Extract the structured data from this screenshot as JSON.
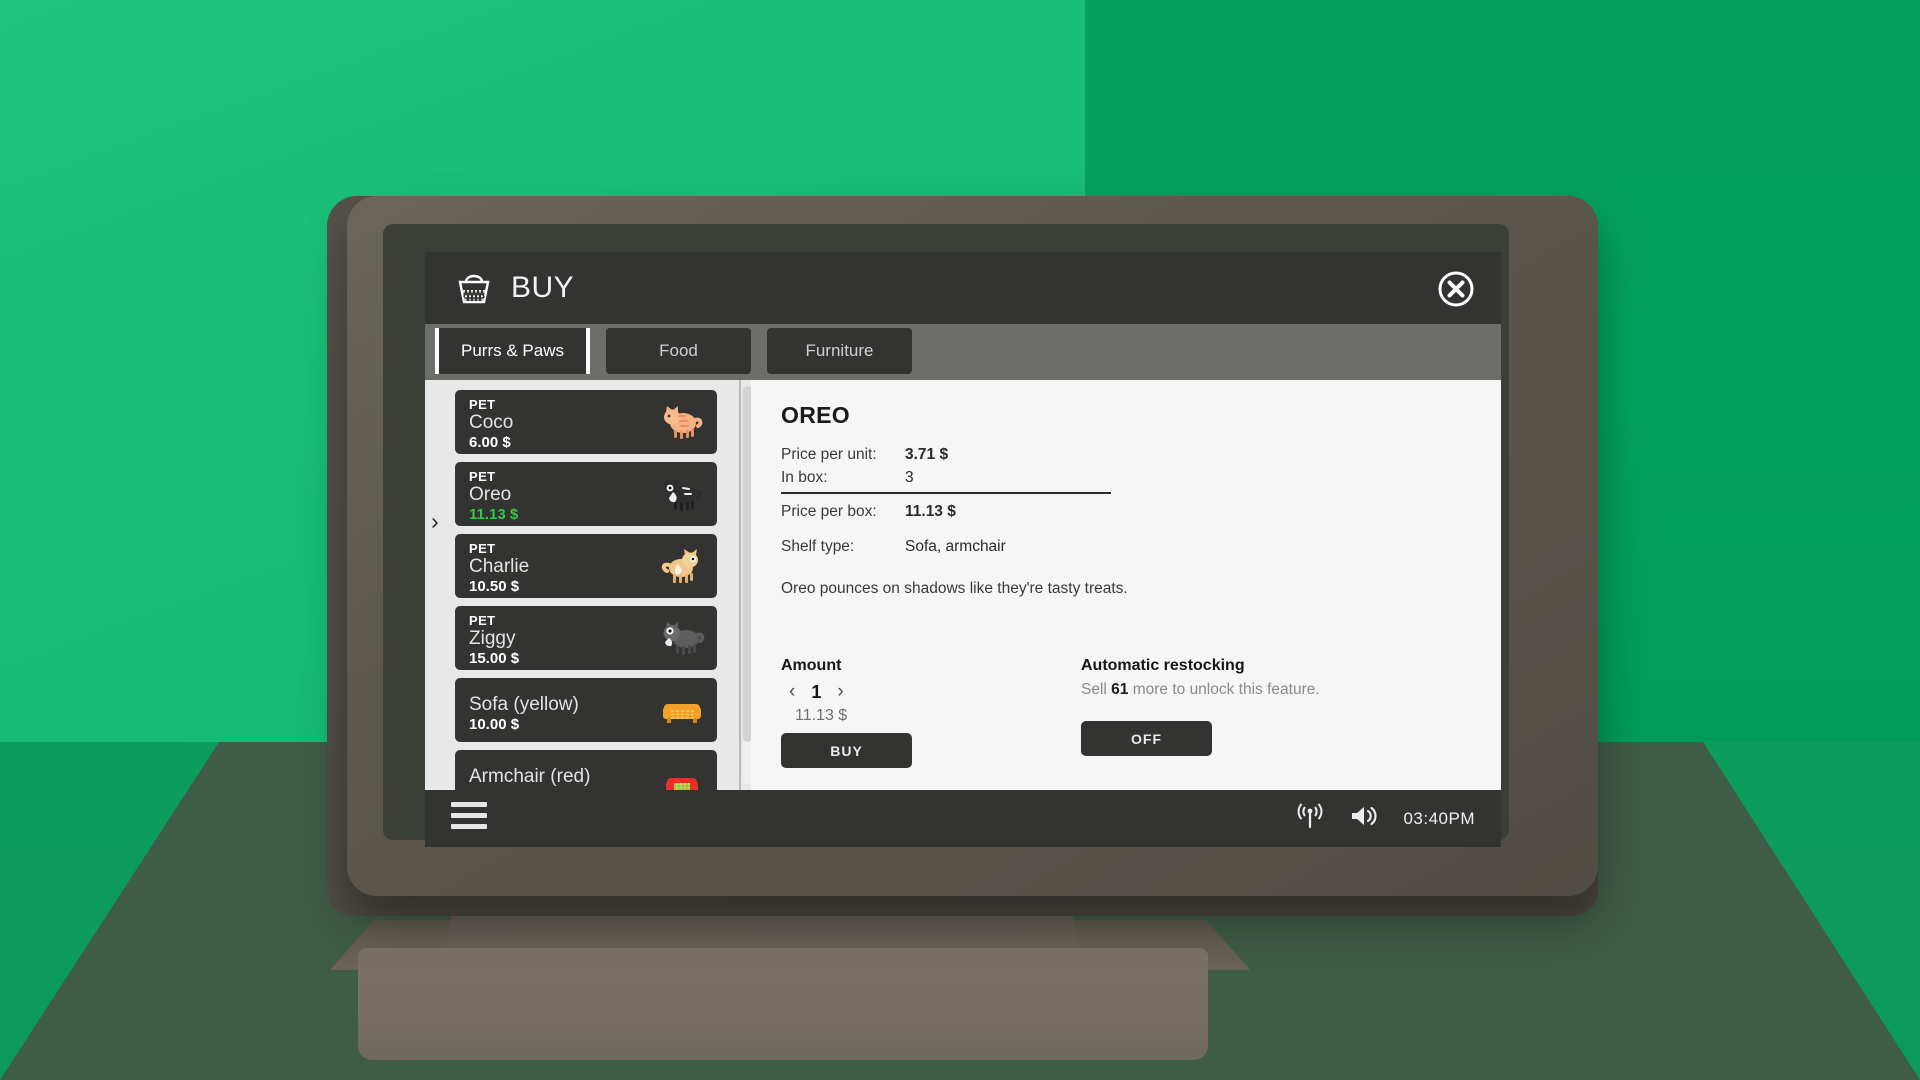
{
  "window": {
    "title": "BUY",
    "basket_icon": "shopping-basket-icon",
    "close_icon": "close-circle-icon"
  },
  "tabs": [
    {
      "label": "Purrs & Paws",
      "active": true
    },
    {
      "label": "Food",
      "active": false
    },
    {
      "label": "Furniture",
      "active": false
    }
  ],
  "catalog": {
    "selected_index": 1,
    "items": [
      {
        "kind": "PET",
        "name": "Coco",
        "price": "6.00 $",
        "icon": "orange-cat-icon",
        "highlight": false,
        "kind_visible": true
      },
      {
        "kind": "PET",
        "name": "Oreo",
        "price": "11.13 $",
        "icon": "black-white-cat-icon",
        "highlight": true,
        "kind_visible": true
      },
      {
        "kind": "PET",
        "name": "Charlie",
        "price": "10.50 $",
        "icon": "tan-cat-icon",
        "highlight": false,
        "kind_visible": true
      },
      {
        "kind": "PET",
        "name": "Ziggy",
        "price": "15.00 $",
        "icon": "grey-cat-icon",
        "highlight": false,
        "kind_visible": true
      },
      {
        "kind": "",
        "name": "Sofa (yellow)",
        "price": "10.00 $",
        "icon": "yellow-sofa-icon",
        "highlight": false,
        "kind_visible": false
      },
      {
        "kind": "",
        "name": "Armchair (red)",
        "price": "",
        "icon": "red-armchair-icon",
        "highlight": false,
        "kind_visible": false
      }
    ]
  },
  "detail": {
    "title": "OREO",
    "specs": [
      {
        "key": "Price per unit:",
        "value": "3.71 $",
        "bold": true
      },
      {
        "key": "In box:",
        "value": "3",
        "bold": false
      },
      {
        "key": "Price per box:",
        "value": "11.13 $",
        "bold": true
      },
      {
        "key": "Shelf type:",
        "value": "Sofa, armchair",
        "bold": false
      }
    ],
    "description": "Oreo pounces on shadows like they're tasty treats."
  },
  "amount": {
    "label": "Amount",
    "dec_icon": "chevron-left-icon",
    "inc_icon": "chevron-right-icon",
    "value": "1",
    "total_price": "11.13 $",
    "buy_label": "BUY"
  },
  "restocking": {
    "label": "Automatic restocking",
    "hint_prefix": "Sell ",
    "hint_count": "61",
    "hint_suffix": " more to unlock this feature.",
    "toggle_label": "OFF"
  },
  "taskbar": {
    "menu_icon": "hamburger-menu-icon",
    "signal_icon": "wifi-broadcast-icon",
    "volume_icon": "speaker-volume-icon",
    "time": "03:40PM"
  },
  "colors": {
    "accent_green": "#2ecc40",
    "panel_dark": "#333331",
    "wall_left": "#17bd78",
    "wall_right": "#04a05d"
  }
}
